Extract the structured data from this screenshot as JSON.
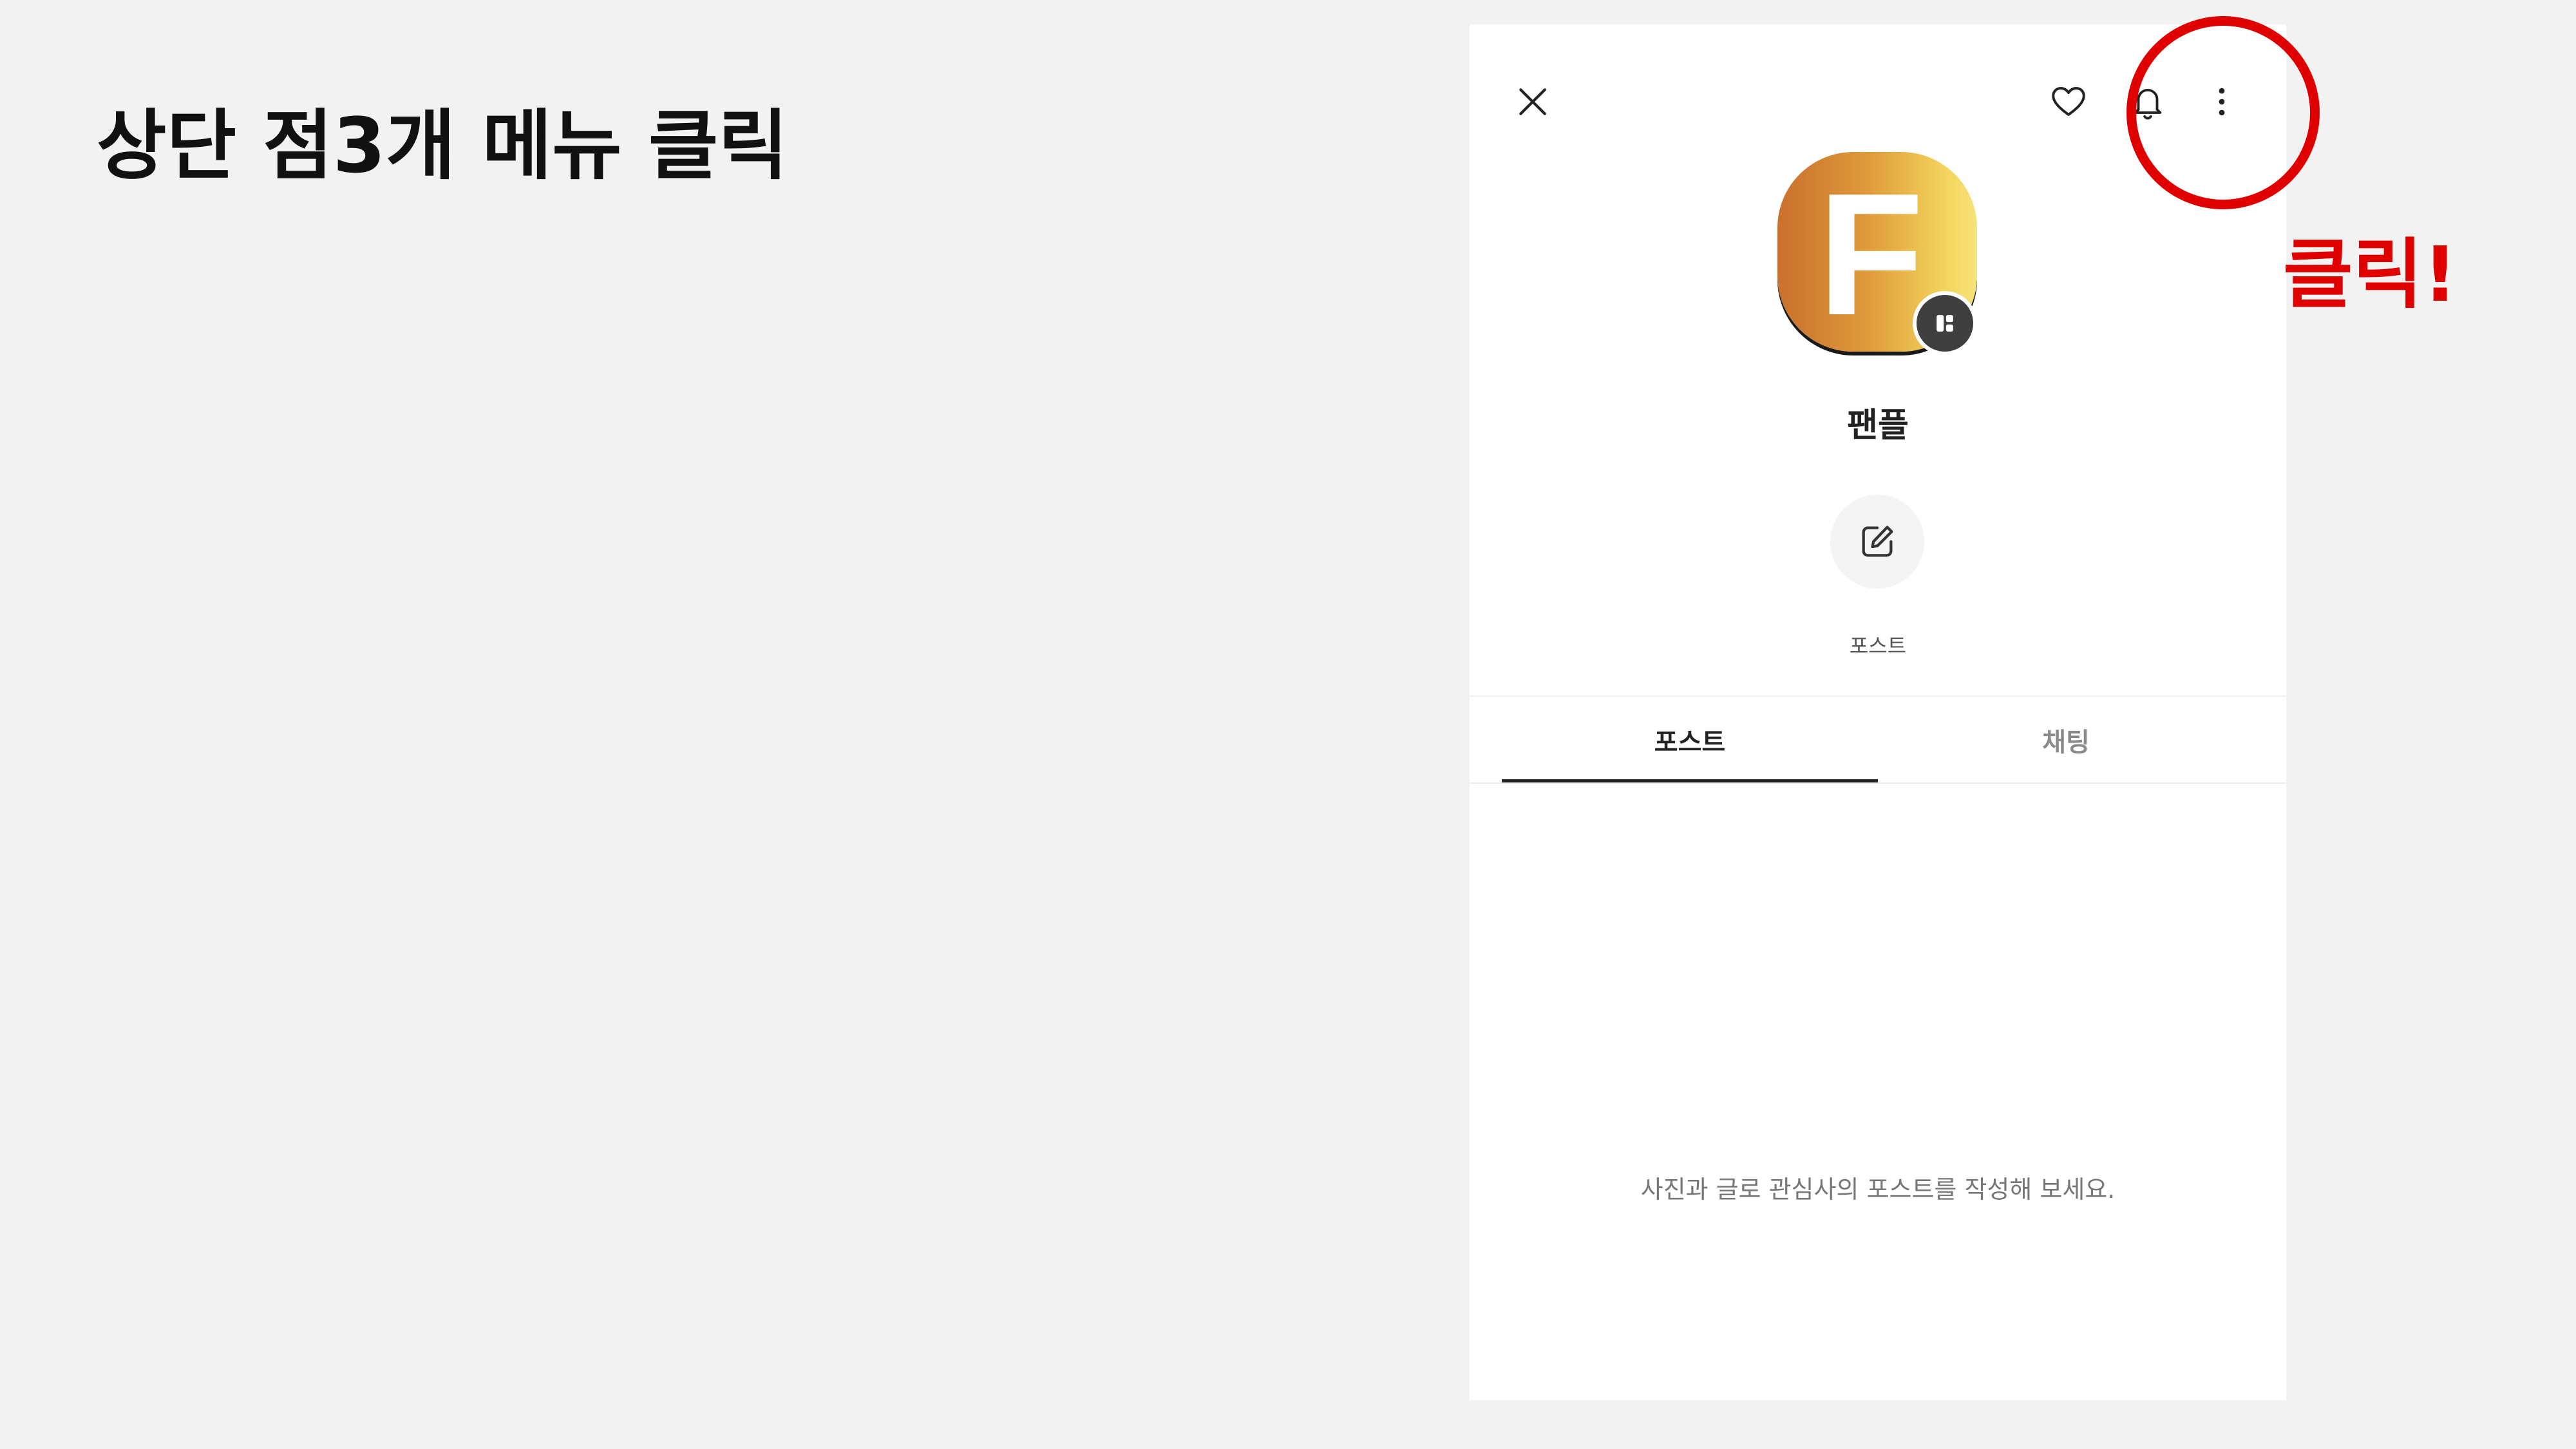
{
  "slide": {
    "title": "상단 점3개 메뉴 클릭"
  },
  "topbar": {
    "close_icon": "close-icon",
    "heart_icon": "heart-icon",
    "bell_icon": "bell-icon",
    "more_icon": "more-vertical-icon"
  },
  "profile": {
    "logo_letter": "F",
    "logo_badge_icon": "board-icon",
    "name": "팬플"
  },
  "action": {
    "icon": "edit-icon",
    "label": "포스트"
  },
  "tabs": [
    {
      "label": "포스트",
      "active": true
    },
    {
      "label": "채팅",
      "active": false
    }
  ],
  "content": {
    "empty_message": "사진과 글로 관심사의 포스트를 작성해 보세요."
  },
  "annotation": {
    "click_label": "클릭!",
    "color": "#e00000"
  }
}
